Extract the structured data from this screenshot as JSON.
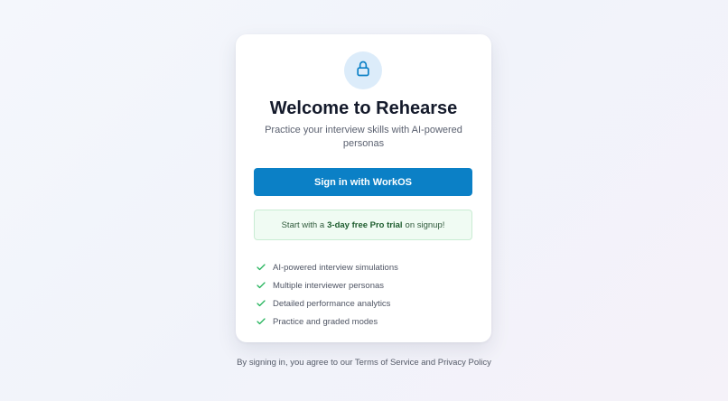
{
  "colors": {
    "accent": "#0b80c6",
    "check": "#22b35a",
    "lock_bg": "#dcecfa",
    "lock_icon": "#0b80c6"
  },
  "card": {
    "icon": "lock-icon",
    "title": "Welcome to Rehearse",
    "subtitle": "Practice your interview skills with AI-powered personas",
    "signin_label": "Sign in with WorkOS",
    "trial": {
      "prefix": "Start with a",
      "highlight": "3-day free Pro trial",
      "suffix": "on signup!"
    },
    "features": [
      "AI-powered interview simulations",
      "Multiple interviewer personas",
      "Detailed performance analytics",
      "Practice and graded modes"
    ]
  },
  "footer": {
    "text": "By signing in, you agree to our Terms of Service and Privacy Policy"
  }
}
